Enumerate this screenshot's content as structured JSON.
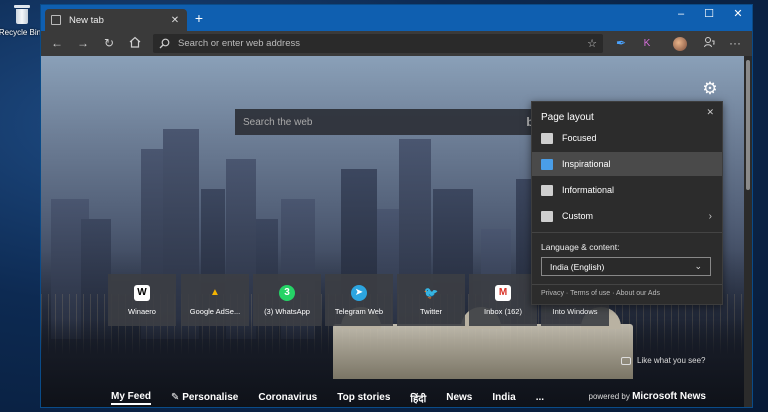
{
  "desktop": {
    "recycle_bin_label": "Recycle Bin"
  },
  "browser": {
    "tab_title": "New tab",
    "address_placeholder": "Search or enter web address"
  },
  "newtab": {
    "search_placeholder": "Search the web",
    "quick_links": [
      {
        "label": "Winaero",
        "icon": "W",
        "icon_name": "winaero-icon",
        "bg": "#ffffff",
        "fg": "#000000"
      },
      {
        "label": "Google AdSe...",
        "icon": "▲",
        "icon_name": "google-adsense-icon",
        "bg": "transparent",
        "fg": "#f4b400"
      },
      {
        "label": "(3) WhatsApp",
        "icon": "3",
        "icon_name": "whatsapp-icon",
        "bg": "#25d366",
        "fg": "#ffffff"
      },
      {
        "label": "Telegram Web",
        "icon": "➤",
        "icon_name": "telegram-icon",
        "bg": "#2ca5e0",
        "fg": "#ffffff"
      },
      {
        "label": "Twitter",
        "icon": "🐦",
        "icon_name": "twitter-icon",
        "bg": "transparent",
        "fg": "#1da1f2"
      },
      {
        "label": "Inbox (162)",
        "icon": "M",
        "icon_name": "gmail-icon",
        "bg": "#ffffff",
        "fg": "#d93025"
      },
      {
        "label": "Into Windows",
        "icon": "",
        "icon_name": "into-windows-icon",
        "bg": "transparent",
        "fg": "#ffffff"
      }
    ],
    "like_what_you_see": "Like what you see?",
    "feed_tabs": [
      "My Feed",
      "Personalise",
      "Coronavirus",
      "Top stories",
      "हिंदी",
      "News",
      "India",
      "..."
    ],
    "powered_by": "powered by",
    "powered_brand": "Microsoft News"
  },
  "page_layout_panel": {
    "title": "Page layout",
    "options": [
      {
        "label": "Focused",
        "selected": false
      },
      {
        "label": "Inspirational",
        "selected": true
      },
      {
        "label": "Informational",
        "selected": false
      },
      {
        "label": "Custom",
        "selected": false
      }
    ],
    "language_label": "Language & content:",
    "language_value": "India (English)",
    "links": [
      "Privacy",
      "Terms of use",
      "About our Ads"
    ]
  },
  "colors": {
    "titlebar": "#0f5fb0",
    "toolbar": "#3a3a3a",
    "panel": "#2c2c2c",
    "selected_row": "#4a4a4a"
  }
}
